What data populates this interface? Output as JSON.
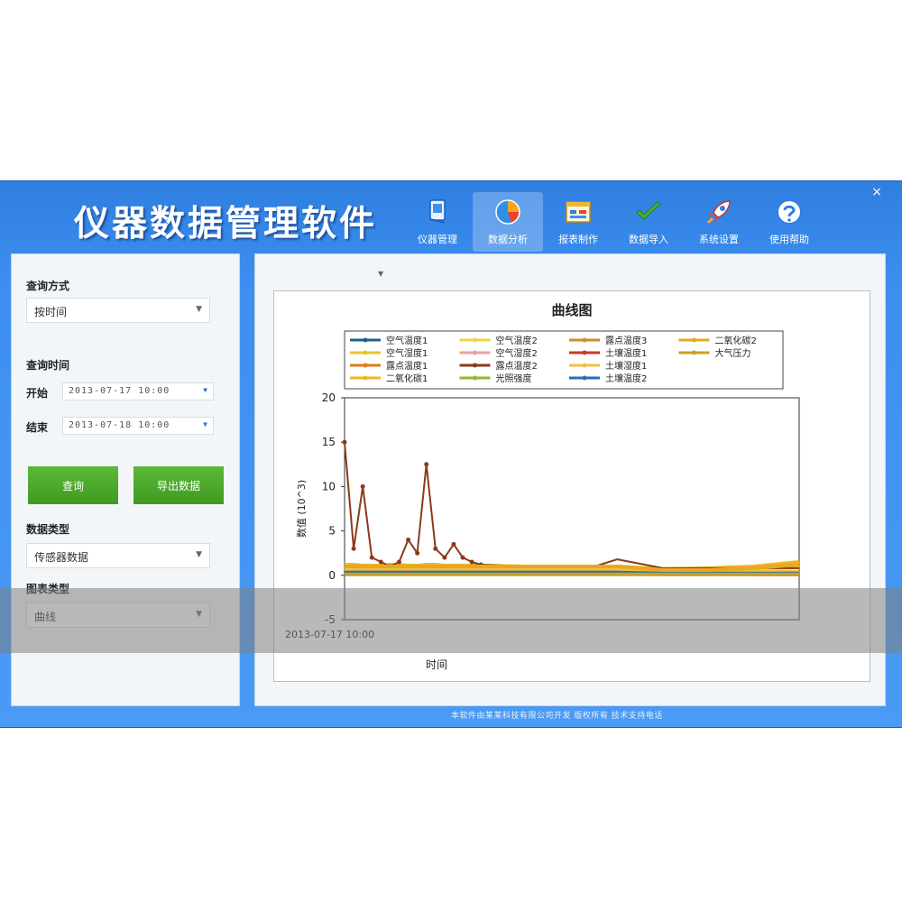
{
  "app": {
    "title": "仪器数据管理软件",
    "close_icon": "×"
  },
  "toolbar": {
    "items": [
      {
        "label": "仪器管理",
        "icon": "device-icon",
        "active": false
      },
      {
        "label": "数据分析",
        "icon": "pie-chart-icon",
        "active": true
      },
      {
        "label": "报表制作",
        "icon": "report-icon",
        "active": false
      },
      {
        "label": "数据导入",
        "icon": "checkmark-icon",
        "active": false
      },
      {
        "label": "系统设置",
        "icon": "rocket-icon",
        "active": false
      },
      {
        "label": "使用帮助",
        "icon": "help-icon",
        "active": false
      }
    ]
  },
  "sidebar": {
    "query_mode": {
      "label": "查询方式",
      "value": "按时间"
    },
    "time_range": {
      "label": "查询时间",
      "start_label": "开始",
      "start_value": "2013-07-17 10:00",
      "end_label": "结束",
      "end_value": "2013-07-18 10:00"
    },
    "query_button": "查询",
    "export_button": "导出数据",
    "data_type": {
      "label": "数据类型",
      "value": "传感器数据"
    },
    "chart_type": {
      "label": "图表类型",
      "value": "曲线"
    }
  },
  "main": {
    "selector": {
      "label": "",
      "value": ""
    }
  },
  "status_bar": "本软件由某某科技有限公司开发 版权所有 技术支持电话",
  "chart_data": {
    "type": "line",
    "title": "曲线图",
    "xlabel": "时间",
    "ylabel": "数值 (10^3)",
    "x_start_label": "2013-07-17 10:00",
    "ylim": [
      -5,
      20
    ],
    "yticks": [
      -5,
      0,
      5,
      10,
      15,
      20
    ],
    "x": [
      0,
      2,
      4,
      6,
      8,
      10,
      12,
      14,
      16,
      18,
      20,
      22,
      24,
      26,
      28,
      30,
      40,
      50,
      55,
      60,
      70,
      80,
      90,
      100
    ],
    "legend_position": "top",
    "series": [
      {
        "name": "空气温度1",
        "color": "#1f5f8b",
        "values": [
          1,
          1,
          1,
          1,
          1,
          1,
          1,
          1,
          1,
          1,
          1,
          1,
          1,
          1,
          1,
          1,
          1,
          1,
          1,
          1,
          0.5,
          0.4,
          0.3,
          0.3
        ]
      },
      {
        "name": "空气湿度1",
        "color": "#e8c530",
        "values": [
          0.8,
          0.9,
          0.8,
          0.8,
          0.9,
          0.9,
          0.8,
          0.8,
          0.9,
          0.9,
          0.9,
          0.9,
          0.9,
          0.9,
          0.9,
          0.9,
          0.9,
          0.9,
          0.9,
          0.9,
          0.5,
          0.6,
          0.8,
          1.1
        ]
      },
      {
        "name": "露点温度1",
        "color": "#e07b1a",
        "values": [
          0.6,
          0.6,
          0.6,
          0.6,
          0.6,
          0.6,
          0.6,
          0.6,
          0.6,
          0.6,
          0.6,
          0.6,
          0.6,
          0.6,
          0.6,
          0.6,
          0.6,
          0.6,
          0.6,
          0.6,
          0.3,
          0.2,
          0.1,
          0.1
        ]
      },
      {
        "name": "二氧化碳1",
        "color": "#f1b520",
        "values": [
          1.2,
          1.2,
          1.1,
          1.1,
          1.1,
          1.2,
          1.2,
          1.1,
          1.1,
          1.2,
          1.2,
          1.1,
          1.1,
          1.1,
          1.1,
          1.1,
          1.0,
          1.0,
          1.0,
          1.0,
          0.7,
          0.8,
          1.0,
          1.5
        ]
      },
      {
        "name": "空气温度2",
        "color": "#f5d240",
        "values": [
          0.9,
          0.9,
          0.9,
          0.9,
          0.9,
          0.9,
          0.9,
          0.9,
          0.9,
          0.9,
          0.9,
          0.9,
          0.9,
          0.9,
          0.9,
          0.9,
          0.9,
          0.9,
          0.9,
          0.9,
          0.6,
          0.6,
          0.7,
          0.9
        ]
      },
      {
        "name": "空气湿度2",
        "color": "#e8a3a0",
        "values": [
          0.4,
          0.4,
          0.4,
          0.4,
          0.4,
          0.4,
          0.4,
          0.4,
          0.4,
          0.4,
          0.4,
          0.4,
          0.4,
          0.4,
          0.4,
          0.4,
          0.4,
          0.4,
          0.4,
          0.4,
          0.2,
          0.2,
          0.2,
          0.2
        ]
      },
      {
        "name": "露点温度2",
        "color": "#8b3a1a",
        "values": [
          15,
          3,
          10,
          2,
          1.5,
          1,
          1.5,
          4,
          2.5,
          12.5,
          3,
          2,
          3.5,
          2,
          1.5,
          1.2,
          1.0,
          1.0,
          1.0,
          1.8,
          0.8,
          0.8,
          0.8,
          0.8
        ]
      },
      {
        "name": "光照强度",
        "color": "#8fb83a",
        "values": [
          0.3,
          0.3,
          0.3,
          0.3,
          0.3,
          0.3,
          0.3,
          0.3,
          0.3,
          0.3,
          0.3,
          0.3,
          0.3,
          0.3,
          0.3,
          0.3,
          0.3,
          0.3,
          0.3,
          0.3,
          0.2,
          0.2,
          0.2,
          0.2
        ]
      },
      {
        "name": "露点温度3",
        "color": "#d28a30",
        "values": [
          0.2,
          0.2,
          0.2,
          0.2,
          0.2,
          0.2,
          0.2,
          0.2,
          0.2,
          0.2,
          0.2,
          0.2,
          0.2,
          0.2,
          0.2,
          0.2,
          0.2,
          0.2,
          0.2,
          0.2,
          0.1,
          0.1,
          0.1,
          0.1
        ]
      },
      {
        "name": "土壤温度1",
        "color": "#c8372a",
        "values": [
          0.5,
          0.5,
          0.5,
          0.5,
          0.5,
          0.5,
          0.5,
          0.5,
          0.5,
          0.5,
          0.5,
          0.5,
          0.5,
          0.5,
          0.5,
          0.5,
          0.5,
          0.5,
          0.5,
          0.5,
          0.3,
          0.3,
          0.3,
          0.3
        ]
      },
      {
        "name": "土壤湿度1",
        "color": "#f0c040",
        "values": [
          0.7,
          0.7,
          0.7,
          0.7,
          0.7,
          0.7,
          0.7,
          0.7,
          0.7,
          0.7,
          0.7,
          0.7,
          0.7,
          0.7,
          0.7,
          0.7,
          0.7,
          0.7,
          0.7,
          0.7,
          0.4,
          0.4,
          0.4,
          0.4
        ]
      },
      {
        "name": "土壤温度2",
        "color": "#2a6fb8",
        "values": [
          0.3,
          0.3,
          0.3,
          0.3,
          0.3,
          0.3,
          0.3,
          0.3,
          0.3,
          0.3,
          0.3,
          0.3,
          0.3,
          0.3,
          0.3,
          0.3,
          0.3,
          0.3,
          0.3,
          0.3,
          0.2,
          0.2,
          0.2,
          0.2
        ]
      },
      {
        "name": "二氧化碳2",
        "color": "#e6a820",
        "values": [
          1.0,
          1.0,
          1.0,
          1.0,
          1.0,
          1.0,
          1.0,
          1.0,
          1.0,
          1.0,
          1.0,
          1.0,
          1.0,
          1.0,
          1.0,
          1.0,
          1.0,
          1.0,
          1.0,
          1.0,
          0.6,
          0.6,
          0.8,
          1.2
        ]
      },
      {
        "name": "大气压力",
        "color": "#c8a020",
        "values": [
          0.1,
          0.1,
          0.1,
          0.1,
          0.1,
          0.1,
          0.1,
          0.1,
          0.1,
          0.1,
          0.1,
          0.1,
          0.1,
          0.1,
          0.1,
          0.1,
          0.1,
          0.1,
          0.1,
          0.1,
          0.1,
          0.1,
          0.1,
          0.1
        ]
      }
    ]
  }
}
